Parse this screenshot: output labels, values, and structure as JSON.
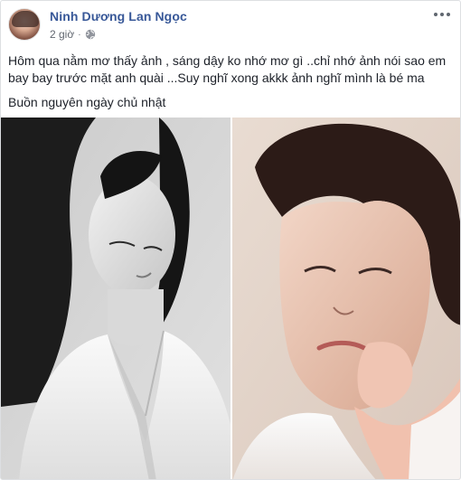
{
  "post": {
    "author_name": "Ninh Dương Lan Ngọc",
    "time": "2 giờ",
    "separator": "·",
    "privacy_icon": "globe-icon",
    "more_icon": "more-options-icon",
    "text_lines": [
      "Hôm qua nằm mơ thấy ảnh , sáng dậy ko nhớ mơ gì ..chỉ nhớ ảnh nói sao em bay bay trước mặt anh quài ...Suy nghĩ xong akkk ảnh nghĩ mình là bé ma",
      "Buồn nguyên ngày chủ nhật"
    ]
  },
  "colors": {
    "author_link": "#385898",
    "meta_text": "#616770",
    "body_text": "#1d2129",
    "border": "#dddfe2"
  }
}
